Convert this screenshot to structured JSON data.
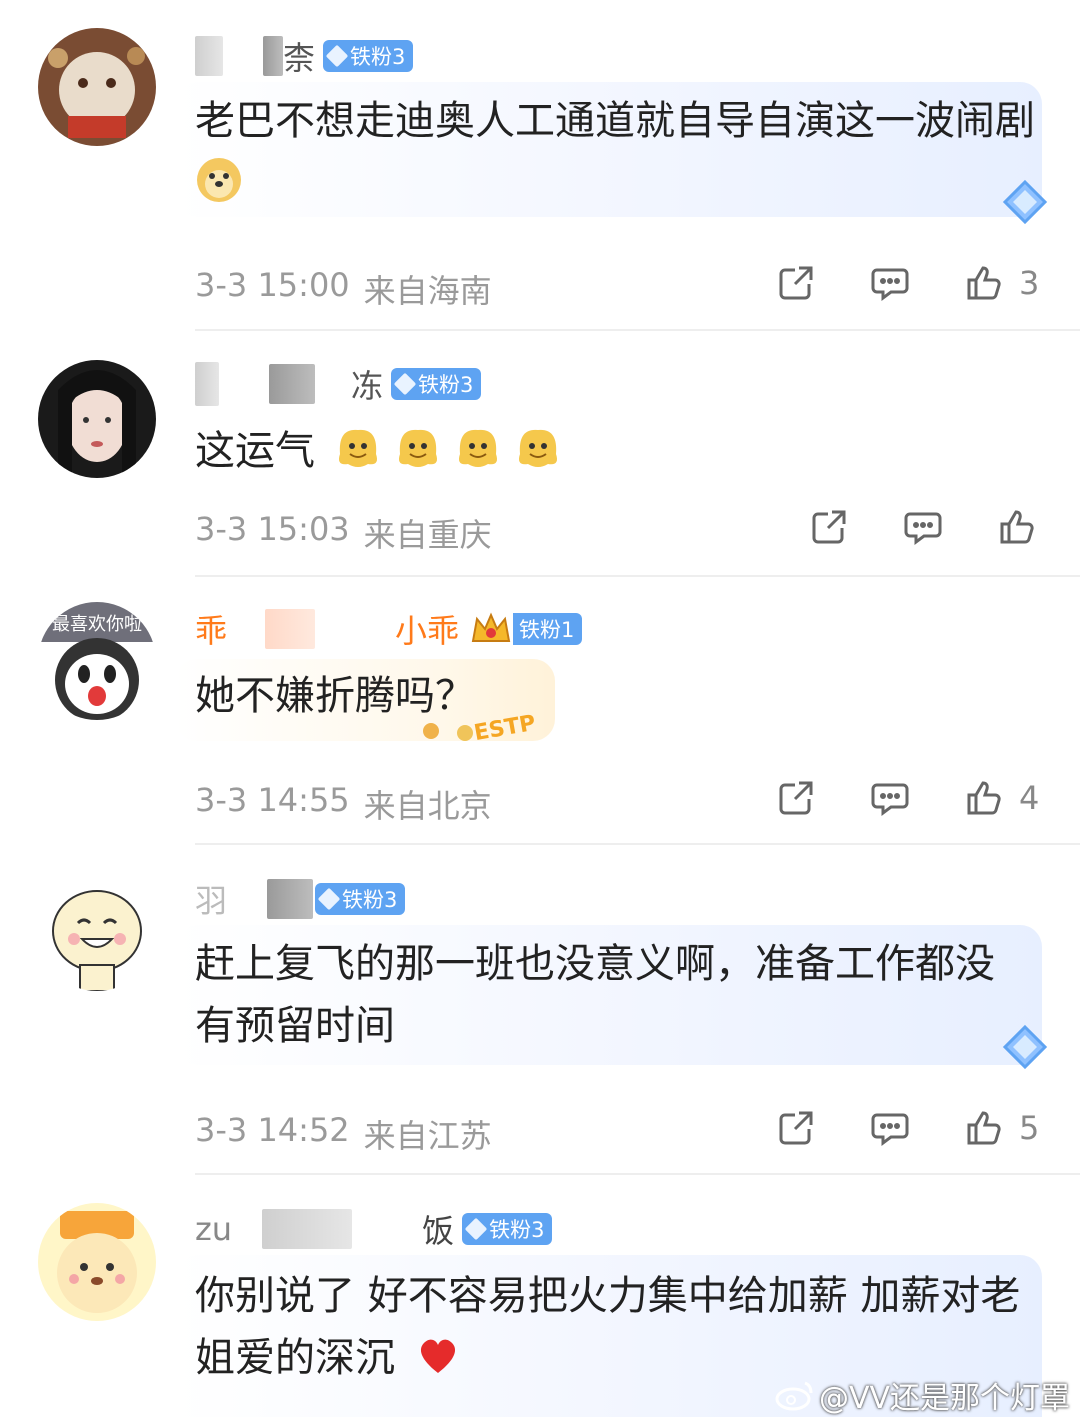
{
  "comments": [
    {
      "name_parts": [
        "",
        "",
        "柰"
      ],
      "badge": "铁粉3",
      "text": "老巴不想走迪奥人工通道就自导自演这一波闹剧",
      "date": "3-3 15:00",
      "location": "来自海南",
      "likes": "3"
    },
    {
      "name_parts": [
        "",
        "",
        "冻"
      ],
      "badge": "铁粉3",
      "text": "这运气",
      "date": "3-3 15:03",
      "location": "来自重庆",
      "likes": ""
    },
    {
      "name_parts": [
        "乖",
        "",
        "小乖"
      ],
      "badge": "铁粉1",
      "text": "她不嫌折腾吗？",
      "date": "3-3 14:55",
      "location": "来自北京",
      "likes": "4",
      "avatar_text": "最喜欢你啦",
      "sticker_text": "ESTP"
    },
    {
      "name_parts": [
        "羽",
        "",
        ""
      ],
      "badge": "铁粉3",
      "text": "赶上复飞的那一班也没意义啊，准备工作都没有预留时间",
      "date": "3-3 14:52",
      "location": "来自江苏",
      "likes": "5"
    },
    {
      "name_parts": [
        "zu",
        "",
        "饭"
      ],
      "badge": "铁粉3",
      "text": "你别说了 好不容易把火力集中给加薪 加薪对老姐爱的深沉",
      "date": "",
      "location": "",
      "likes": ""
    }
  ],
  "watermark": "@VV还是那个灯罩",
  "colors": {
    "badge": "#5ea3f2",
    "orange_name": "#ff7a1a",
    "meta": "#9a9a9a"
  },
  "icons": [
    "share-icon",
    "comment-icon",
    "like-icon",
    "diamond-icon",
    "weibo-icon"
  ]
}
